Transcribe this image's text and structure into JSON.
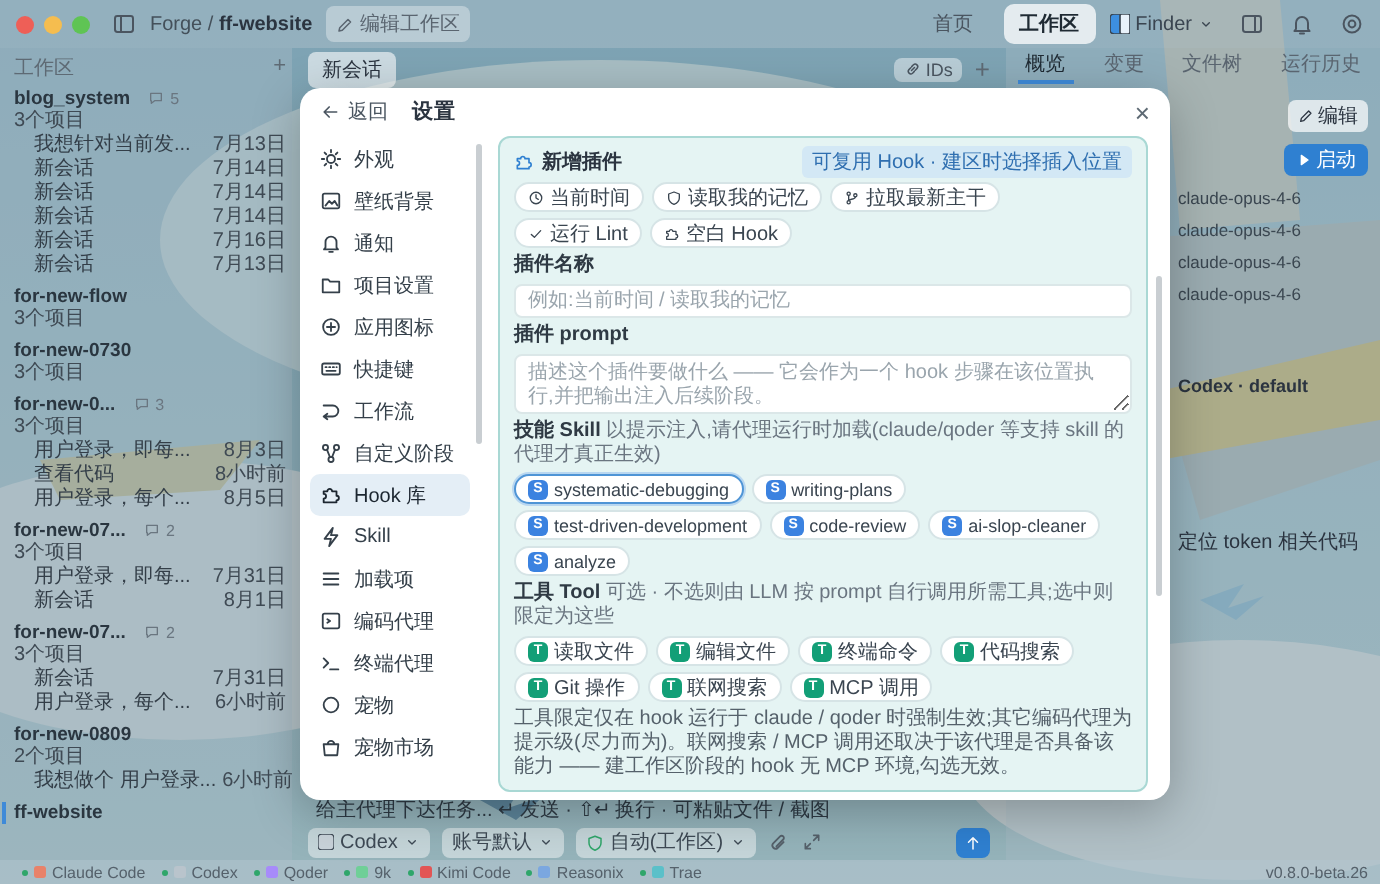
{
  "titlebar": {
    "path": "Forge / **ff-website**",
    "edit_label": "编辑工作区",
    "nav": [
      {
        "label": "首页",
        "selected": false
      },
      {
        "label": "工作区",
        "selected": true
      }
    ],
    "finder": "Finder"
  },
  "sidebar": {
    "title": "工作区",
    "add": "+",
    "projects": [
      {
        "name": "blog_system",
        "subtitle": "3个项目",
        "count": "5",
        "selected": false,
        "sessions": [
          {
            "title": "我想针对当前发...",
            "time": "7月13日"
          },
          {
            "title": "新会话",
            "time": "7月14日"
          },
          {
            "title": "新会话",
            "time": "7月14日"
          },
          {
            "title": "新会话",
            "time": "7月14日"
          },
          {
            "title": "新会话",
            "time": "7月16日"
          },
          {
            "title": "新会话",
            "time": "7月13日"
          }
        ]
      },
      {
        "name": "for-new-flow",
        "subtitle": "3个项目",
        "selected": false
      },
      {
        "name": "for-new-0730",
        "subtitle": "3个项目",
        "selected": false
      },
      {
        "name": "for-new-0...",
        "subtitle": "3个项目",
        "count": "3",
        "selected": false,
        "sessions": [
          {
            "title": "用户登录，即每...",
            "time": "8月3日"
          },
          {
            "title": "查看代码",
            "time": "8小时前"
          },
          {
            "title": "用户登录，每个...",
            "time": "8月5日"
          }
        ]
      },
      {
        "name": "for-new-07...",
        "subtitle": "3个项目",
        "count": "2",
        "selected": false,
        "sessions": [
          {
            "title": "用户登录，即每...",
            "time": "7月31日"
          },
          {
            "title": "新会话",
            "time": "8月1日"
          }
        ]
      },
      {
        "name": "for-new-07...",
        "subtitle": "3个项目",
        "count": "2",
        "selected": false,
        "sessions": [
          {
            "title": "新会话",
            "time": "7月31日"
          },
          {
            "title": "用户登录，每个...",
            "time": "6小时前"
          }
        ]
      },
      {
        "name": "for-new-0809",
        "subtitle": "2个项目",
        "selected": false,
        "sessions": [
          {
            "title": "我想做个 用户登录...",
            "time": "6小时前"
          }
        ]
      },
      {
        "name": "ff-website",
        "selected": true
      }
    ]
  },
  "session_tab": "新会话",
  "ids_button": "IDs",
  "new_tab": "+",
  "composer": {
    "placeholder": "给主代理下达任务... ↵ 发送 · ⇧↵ 换行 · 可粘贴文件 / 截图",
    "agent": "Codex",
    "account": "账号默认",
    "mode": "自动(工作区)"
  },
  "right_panel": {
    "tabs": [
      {
        "label": "概览",
        "selected": true
      },
      {
        "label": "变更",
        "selected": false
      },
      {
        "label": "文件树",
        "selected": false
      },
      {
        "label": "运行历史",
        "selected": false
      }
    ],
    "edit": "编辑",
    "start": "启动",
    "models": [
      "claude-opus-4-6",
      "claude-opus-4-6",
      "claude-opus-4-6",
      "claude-opus-4-6"
    ],
    "agent": "Codex · default",
    "quick_prompt": "定位 token 相关代码"
  },
  "status_bar": {
    "agents": [
      {
        "name": "Claude Code",
        "color": "#e8826a"
      },
      {
        "name": "Codex",
        "color": "#b9c4cc"
      },
      {
        "name": "Qoder",
        "color": "#a78bfa"
      },
      {
        "name": "9k",
        "color": "#6fcf97"
      },
      {
        "name": "Kimi Code",
        "color": "#e25555"
      },
      {
        "name": "Reasonix",
        "color": "#7ba7e0"
      },
      {
        "name": "Trae",
        "color": "#5bc0c9"
      }
    ],
    "version": "v0.8.0-beta.26"
  },
  "settings_dialog": {
    "back": "返回",
    "title": "设置",
    "close": "×",
    "nav": [
      {
        "label": "外观",
        "selected": false
      },
      {
        "label": "壁纸背景",
        "selected": false
      },
      {
        "label": "通知",
        "selected": false
      },
      {
        "label": "项目设置",
        "selected": false
      },
      {
        "label": "应用图标",
        "selected": false
      },
      {
        "label": "快捷键",
        "selected": false
      },
      {
        "label": "工作流",
        "selected": false
      },
      {
        "label": "自定义阶段",
        "selected": false
      },
      {
        "label": "Hook 库",
        "selected": true
      },
      {
        "label": "Skill",
        "selected": false
      },
      {
        "label": "加载项",
        "selected": false
      },
      {
        "label": "编码代理",
        "selected": false
      },
      {
        "label": "终端代理",
        "selected": false
      },
      {
        "label": "宠物",
        "selected": false
      },
      {
        "label": "宠物市场",
        "selected": false
      }
    ],
    "plugin_form": {
      "title": "新增插件",
      "hint": "可复用 Hook · 建区时选择插入位置",
      "presets": [
        "当前时间",
        "读取我的记忆",
        "拉取最新主干",
        "运行 Lint",
        "空白 Hook"
      ],
      "name_label": "插件名称",
      "name_placeholder": "例如:当前时间 / 读取我的记忆",
      "prompt_label": "插件 prompt",
      "prompt_placeholder": "描述这个插件要做什么 —— 它会作为一个 hook 步骤在该位置执行,并把输出注入后续阶段。",
      "skill_label": "技能 Skill",
      "skill_hint": "以提示注入,请代理运行时加载(claude/qoder 等支持 skill 的代理才真正生效)",
      "skills": [
        {
          "badge": "S",
          "name": "systematic-debugging",
          "selected": true
        },
        {
          "badge": "S",
          "name": "writing-plans",
          "selected": false
        },
        {
          "badge": "S",
          "name": "test-driven-development",
          "selected": false
        },
        {
          "badge": "S",
          "name": "code-review",
          "selected": false
        },
        {
          "badge": "S",
          "name": "ai-slop-cleaner",
          "selected": false
        },
        {
          "badge": "S",
          "name": "analyze",
          "selected": false
        }
      ],
      "tool_label": "工具 Tool",
      "tool_hint": "可选 · 不选则由 LLM 按 prompt 自行调用所需工具;选中则限定为这些",
      "tools": [
        {
          "badge": "T",
          "name": "读取文件",
          "selected": false
        },
        {
          "badge": "T",
          "name": "编辑文件",
          "selected": false
        },
        {
          "badge": "T",
          "name": "终端命令",
          "selected": false
        },
        {
          "badge": "T",
          "name": "代码搜索",
          "selected": false
        },
        {
          "badge": "T",
          "name": "Git 操作",
          "selected": false
        },
        {
          "badge": "T",
          "name": "联网搜索",
          "selected": false
        },
        {
          "badge": "T",
          "name": "MCP 调用",
          "selected": false
        }
      ],
      "note": "工具限定仅在 hook 运行于 claude / qoder 时强制生效;其它编码代理为提示级(尽力而为)。联网搜索 / MCP 调用还取决于该代理是否具备该能力 —— 建工作区阶段的 hook 无 MCP 环境,勾选无效。"
    }
  }
}
